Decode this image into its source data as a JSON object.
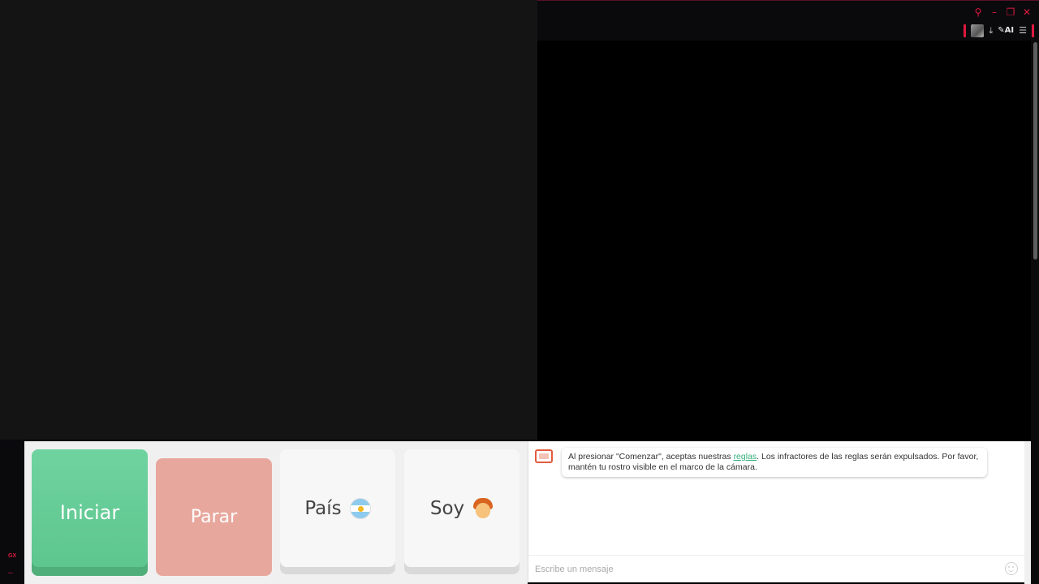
{
  "window": {
    "icons": [
      "search-icon",
      "minimize-icon",
      "restore-icon",
      "close-icon"
    ]
  },
  "toolbar": {
    "download_icon": "download-icon",
    "ai_label": "AI",
    "menu_icon": "menu-icon"
  },
  "left_strip": {
    "label_top": "GX",
    "label_bottom": "..."
  },
  "controls": {
    "start_label": "Iniciar",
    "stop_label": "Parar",
    "country_label": "País",
    "gender_label": "Soy"
  },
  "chat": {
    "message_before_link": "Al presionar \"Comenzar\", aceptas nuestras ",
    "link_text": "reglas",
    "message_after_link": ". Los infractores de las reglas serán expulsados. Por favor, mantén tu rostro visible en el marco de la cámara.",
    "input_placeholder": "Escribe un mensaje"
  },
  "colors": {
    "accent": "#e0193f",
    "start": "#5cc58d",
    "stop": "#e8a79d",
    "link": "#2fae7a"
  }
}
